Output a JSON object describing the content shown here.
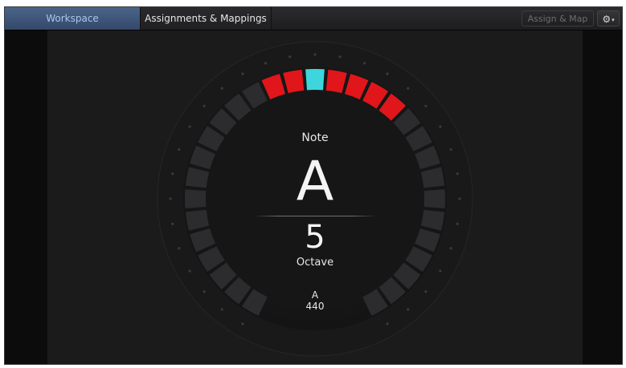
{
  "tabs": [
    {
      "label": "Workspace",
      "active": true
    },
    {
      "label": "Assignments & Mappings",
      "active": false
    }
  ],
  "toolbar": {
    "assign_map_label": "Assign & Map",
    "gear_icon": "gear-icon"
  },
  "tuner": {
    "note_label": "Note",
    "note_name": "A",
    "octave_number": "5",
    "octave_label": "Octave",
    "reference_note": "A",
    "reference_frequency": "440",
    "segments_total": 31,
    "segments_lit": [
      13,
      14,
      16,
      17,
      18,
      19
    ],
    "segment_center": 15,
    "colors": {
      "center": "#3ed6dd",
      "lit": "#e0161a",
      "unlit": "#2c2c2e",
      "ring": "#232325",
      "scale_text": "#3a3a3c"
    }
  }
}
